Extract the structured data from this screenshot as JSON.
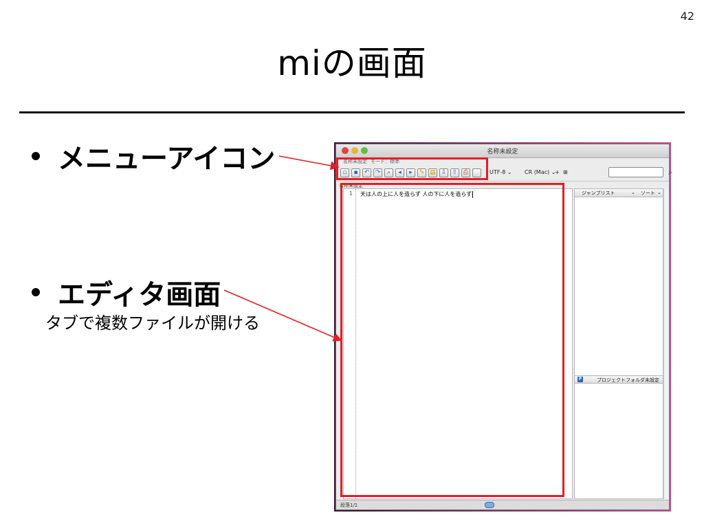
{
  "slide": {
    "page_number": "42",
    "title": "miの画面",
    "bullets": [
      {
        "label": "メニューアイコン"
      },
      {
        "label": "エディタ画面"
      }
    ],
    "sub_text": "タブで複数ファイルが開ける"
  },
  "screenshot": {
    "window_title": "名称未設定",
    "menu_items": [
      "名称未設定",
      "モード：標準"
    ],
    "toolbar": {
      "icons": [
        "new-doc-icon",
        "save-icon",
        "undo-icon",
        "redo-icon",
        "find-icon",
        "find-prev-icon",
        "find-next-icon",
        "highlight-icon",
        "folder-icon",
        "import-icon",
        "export-icon",
        "print-icon"
      ],
      "encoding": "UTF-8",
      "line_ending": "CR (Mac)",
      "search_placeholder": ""
    },
    "tab_label": "名称未設定",
    "editor": {
      "line_number": "1",
      "text": "天は人の上に人を造らず 人の下に人を造らず"
    },
    "sidebar": {
      "tab_jump": "ジャンプリスト",
      "tab_sort": "ソート",
      "project_label": "プロジェクトフォルダ未設定"
    },
    "status": "段落1/1"
  },
  "colors": {
    "highlight": "#e31e24",
    "accent": "#2a63b4"
  }
}
